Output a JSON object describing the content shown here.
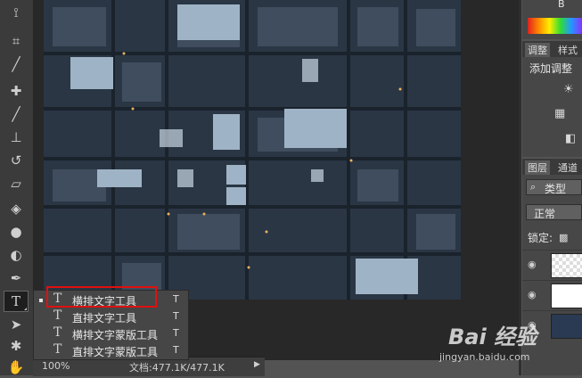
{
  "toolbar": {
    "tools": [
      "lasso-tool-icon",
      "crop-tool-icon",
      "eyedropper-tool-icon",
      "healing-brush-tool-icon",
      "brush-tool-icon",
      "clone-stamp-tool-icon",
      "history-brush-tool-icon",
      "eraser-tool-icon",
      "paint-bucket-tool-icon",
      "blur-tool-icon",
      "dodge-tool-icon",
      "pen-tool-icon",
      "type-tool-icon",
      "path-selection-tool-icon",
      "custom-shape-tool-icon",
      "hand-tool-icon"
    ],
    "type_tool_glyph": "T"
  },
  "flyout": {
    "items": [
      {
        "label": "横排文字工具",
        "shortcut": "T",
        "icon": "horizontal-type-icon",
        "selected": true
      },
      {
        "label": "直排文字工具",
        "shortcut": "T",
        "icon": "vertical-type-icon",
        "selected": false
      },
      {
        "label": "横排文字蒙版工具",
        "shortcut": "T",
        "icon": "horizontal-type-mask-icon",
        "selected": false
      },
      {
        "label": "直排文字蒙版工具",
        "shortcut": "T",
        "icon": "vertical-type-mask-icon",
        "selected": false
      }
    ]
  },
  "status": {
    "zoom": "100%",
    "doc": "文档:477.1K/477.1K"
  },
  "panels": {
    "color_tab_b": "B",
    "adjust_tab": "调整",
    "style_tab": "样式",
    "add_adjustment": "添加调整",
    "layers_tab": "图层",
    "channels_tab": "通道",
    "filter_kind": "类型",
    "blend_mode": "正常",
    "lock_label": "锁定:"
  },
  "watermark": {
    "brand": "Bai 经验",
    "url": "jingyan.baidu.com"
  },
  "colors": {
    "highlight": "#e01010",
    "photo_base": "#2b3745"
  }
}
